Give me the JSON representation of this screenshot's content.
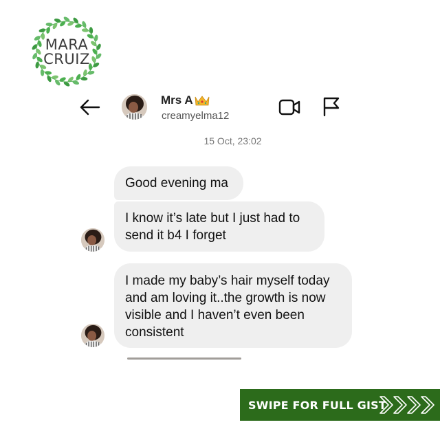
{
  "logo": {
    "text_line1": "MARA",
    "text_line2": "CRUIZ"
  },
  "header": {
    "contact_name": "Mrs A",
    "contact_handle": "creamyelma12",
    "icons": [
      "back-arrow-icon",
      "crown-icon",
      "video-camera-icon",
      "flag-icon"
    ]
  },
  "conversation": {
    "timestamp": "15 Oct, 23:02",
    "messages": [
      {
        "lines": [
          "Good evening ma"
        ]
      },
      {
        "lines": [
          "I know it’s late but I just had to",
          "send it b4 I forget"
        ]
      },
      {
        "lines": [
          "I made my baby’s hair myself today",
          "and am loving it..the growth is now",
          "visible and I haven’t even been",
          "consistent"
        ]
      }
    ]
  },
  "banner": {
    "label": "SWIPE FOR FULL GIST",
    "color": "#2c6b1b",
    "icon": "chevrons-right-icon"
  },
  "colors": {
    "bubble": "#efefef",
    "logo_green": "#4caf50"
  }
}
